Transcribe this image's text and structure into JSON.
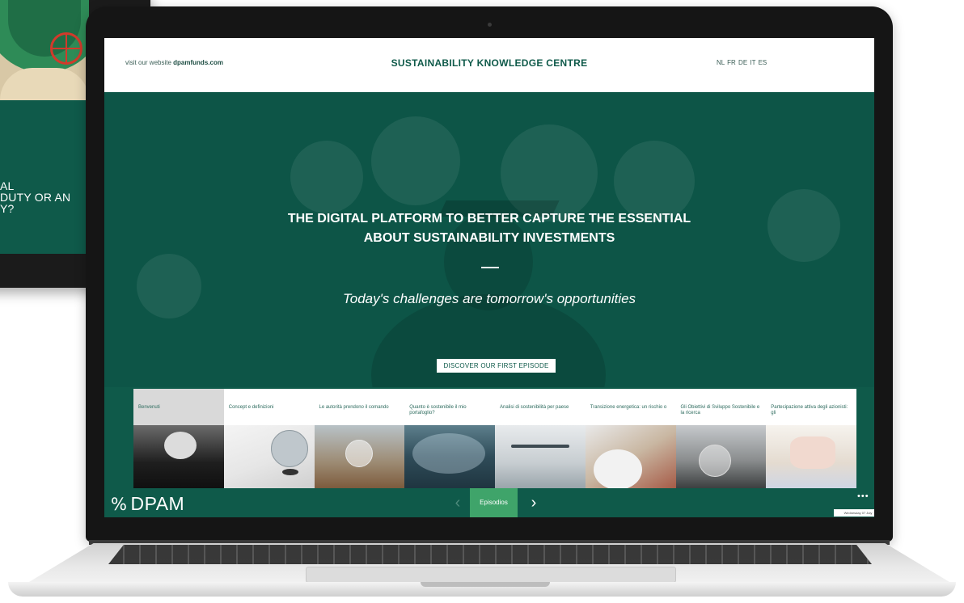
{
  "background_device": {
    "lines": [
      "AL",
      "DUTY OR AN",
      "Y?"
    ]
  },
  "header": {
    "visit_prefix": "visit our website",
    "visit_link": "dpamfunds.com",
    "title": "SUSTAINABILITY KNOWLEDGE CENTRE",
    "languages": "NL FR DE IT ES"
  },
  "hero": {
    "title_line1": "THE DIGITAL PLATFORM TO BETTER CAPTURE THE ESSENTIAL",
    "title_line2": "ABOUT SUSTAINABILITY INVESTMENTS",
    "tagline": "Today's challenges are tomorrow's opportunities",
    "cta_label": "DISCOVER OUR FIRST EPISODE"
  },
  "episodes": [
    {
      "label": "Benvenuti",
      "active": true
    },
    {
      "label": "Concept e definizioni",
      "active": false
    },
    {
      "label": "Le autorità prendono il comando",
      "active": false
    },
    {
      "label": "Quanto è sostenibile il mio portafoglio?",
      "active": false
    },
    {
      "label": "Analisi di sostenibilità per paese",
      "active": false
    },
    {
      "label": "Transizione energetica: un rischio o",
      "active": false
    },
    {
      "label": "Gli Obiettivi di Sviluppo Sostenibile e la ricerca",
      "active": false
    },
    {
      "label": "Partecipazione attiva degli azionisti: gli",
      "active": false
    }
  ],
  "bottom_bar": {
    "logo_symbol": "%",
    "logo_text": "DPAM",
    "prev_glyph": "‹",
    "current_label": "Episodios",
    "next_glyph": "›",
    "more_glyph": "•••",
    "date_text": "Wednesday 07 July"
  },
  "colors": {
    "brand_green": "#0f5a4a",
    "accent_green": "#3fa46a",
    "header_bg": "#ffffff"
  },
  "icons": {
    "prev": "chevron-left-icon",
    "next": "chevron-right-icon",
    "more": "more-dots-icon",
    "logo": "dpam-percent-logo"
  }
}
